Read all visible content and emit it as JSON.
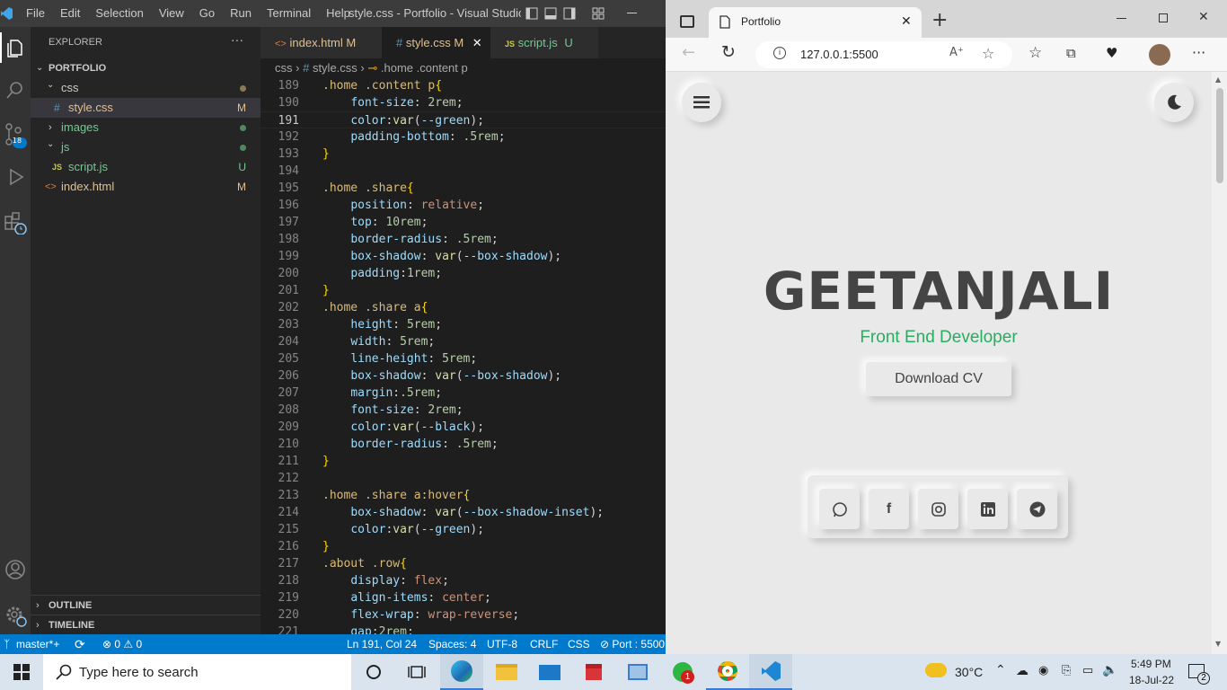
{
  "vscode": {
    "title": "style.css - Portfolio - Visual Studio ...",
    "menu": [
      "File",
      "Edit",
      "Selection",
      "View",
      "Go",
      "Run",
      "Terminal",
      "Help"
    ],
    "activity_badge": "18",
    "explorer": {
      "header": "EXPLORER",
      "more": "···",
      "project": "PORTFOLIO",
      "items": [
        {
          "label": "css",
          "kind": "folder-open",
          "status": ""
        },
        {
          "label": "style.css",
          "kind": "css-file",
          "status": "M"
        },
        {
          "label": "images",
          "kind": "folder",
          "status": ""
        },
        {
          "label": "js",
          "kind": "folder-open",
          "status": ""
        },
        {
          "label": "script.js",
          "kind": "js-file",
          "status": "U"
        },
        {
          "label": "index.html",
          "kind": "html-file",
          "status": "M"
        }
      ],
      "outline": "OUTLINE",
      "timeline": "TIMELINE"
    },
    "tabs": [
      {
        "label": "index.html",
        "status": "M",
        "active": false
      },
      {
        "label": "style.css",
        "status": "M",
        "active": true
      },
      {
        "label": "script.js",
        "status": "U",
        "active": false
      }
    ],
    "breadcrumb": {
      "folder": "css",
      "file": "style.css",
      "symbol": ".home .content p"
    },
    "code_lines": [
      {
        "n": "189",
        "t": ".home .content p{"
      },
      {
        "n": "190",
        "t": "    font-size: 2rem;"
      },
      {
        "n": "191",
        "t": "    color:var(--green);"
      },
      {
        "n": "192",
        "t": "    padding-bottom: .5rem;"
      },
      {
        "n": "193",
        "t": "}"
      },
      {
        "n": "194",
        "t": ""
      },
      {
        "n": "195",
        "t": ".home .share{"
      },
      {
        "n": "196",
        "t": "    position: relative;"
      },
      {
        "n": "197",
        "t": "    top: 10rem;"
      },
      {
        "n": "198",
        "t": "    border-radius: .5rem;"
      },
      {
        "n": "199",
        "t": "    box-shadow: var(--box-shadow);"
      },
      {
        "n": "200",
        "t": "    padding:1rem;"
      },
      {
        "n": "201",
        "t": "}"
      },
      {
        "n": "202",
        "t": ".home .share a{"
      },
      {
        "n": "203",
        "t": "    height: 5rem;"
      },
      {
        "n": "204",
        "t": "    width: 5rem;"
      },
      {
        "n": "205",
        "t": "    line-height: 5rem;"
      },
      {
        "n": "206",
        "t": "    box-shadow: var(--box-shadow);"
      },
      {
        "n": "207",
        "t": "    margin:.5rem;"
      },
      {
        "n": "208",
        "t": "    font-size: 2rem;"
      },
      {
        "n": "209",
        "t": "    color:var(--black);"
      },
      {
        "n": "210",
        "t": "    border-radius: .5rem;"
      },
      {
        "n": "211",
        "t": "}"
      },
      {
        "n": "212",
        "t": ""
      },
      {
        "n": "213",
        "t": ".home .share a:hover{"
      },
      {
        "n": "214",
        "t": "    box-shadow: var(--box-shadow-inset);"
      },
      {
        "n": "215",
        "t": "    color:var(--green);"
      },
      {
        "n": "216",
        "t": "}"
      },
      {
        "n": "217",
        "t": ".about .row{"
      },
      {
        "n": "218",
        "t": "    display: flex;"
      },
      {
        "n": "219",
        "t": "    align-items: center;"
      },
      {
        "n": "220",
        "t": "    flex-wrap: wrap-reverse;"
      },
      {
        "n": "221",
        "t": "    gap:2rem;"
      }
    ],
    "status": {
      "branch": "master*+",
      "errors": "0",
      "warnings": "0",
      "position": "Ln 191, Col 24",
      "spaces": "Spaces: 4",
      "encoding": "UTF-8",
      "eol": "CRLF",
      "language": "CSS",
      "port": "Port : 5500"
    }
  },
  "browser": {
    "tab_title": "Portfolio",
    "url": "127.0.0.1:5500",
    "page": {
      "name": "GEETANJALI",
      "role": "Front End Developer",
      "cta": "Download CV",
      "social": [
        "whatsapp",
        "facebook",
        "instagram",
        "linkedin",
        "telegram"
      ]
    }
  },
  "taskbar": {
    "search_placeholder": "Type here to search",
    "weather": "30°C",
    "time": "5:49 PM",
    "date": "18-Jul-22",
    "notifications": "2",
    "whatsapp_badge": "1"
  },
  "colors": {
    "accent": "#007acc",
    "green": "#27ae60",
    "modified": "#e2c08d",
    "untracked": "#73c991"
  }
}
